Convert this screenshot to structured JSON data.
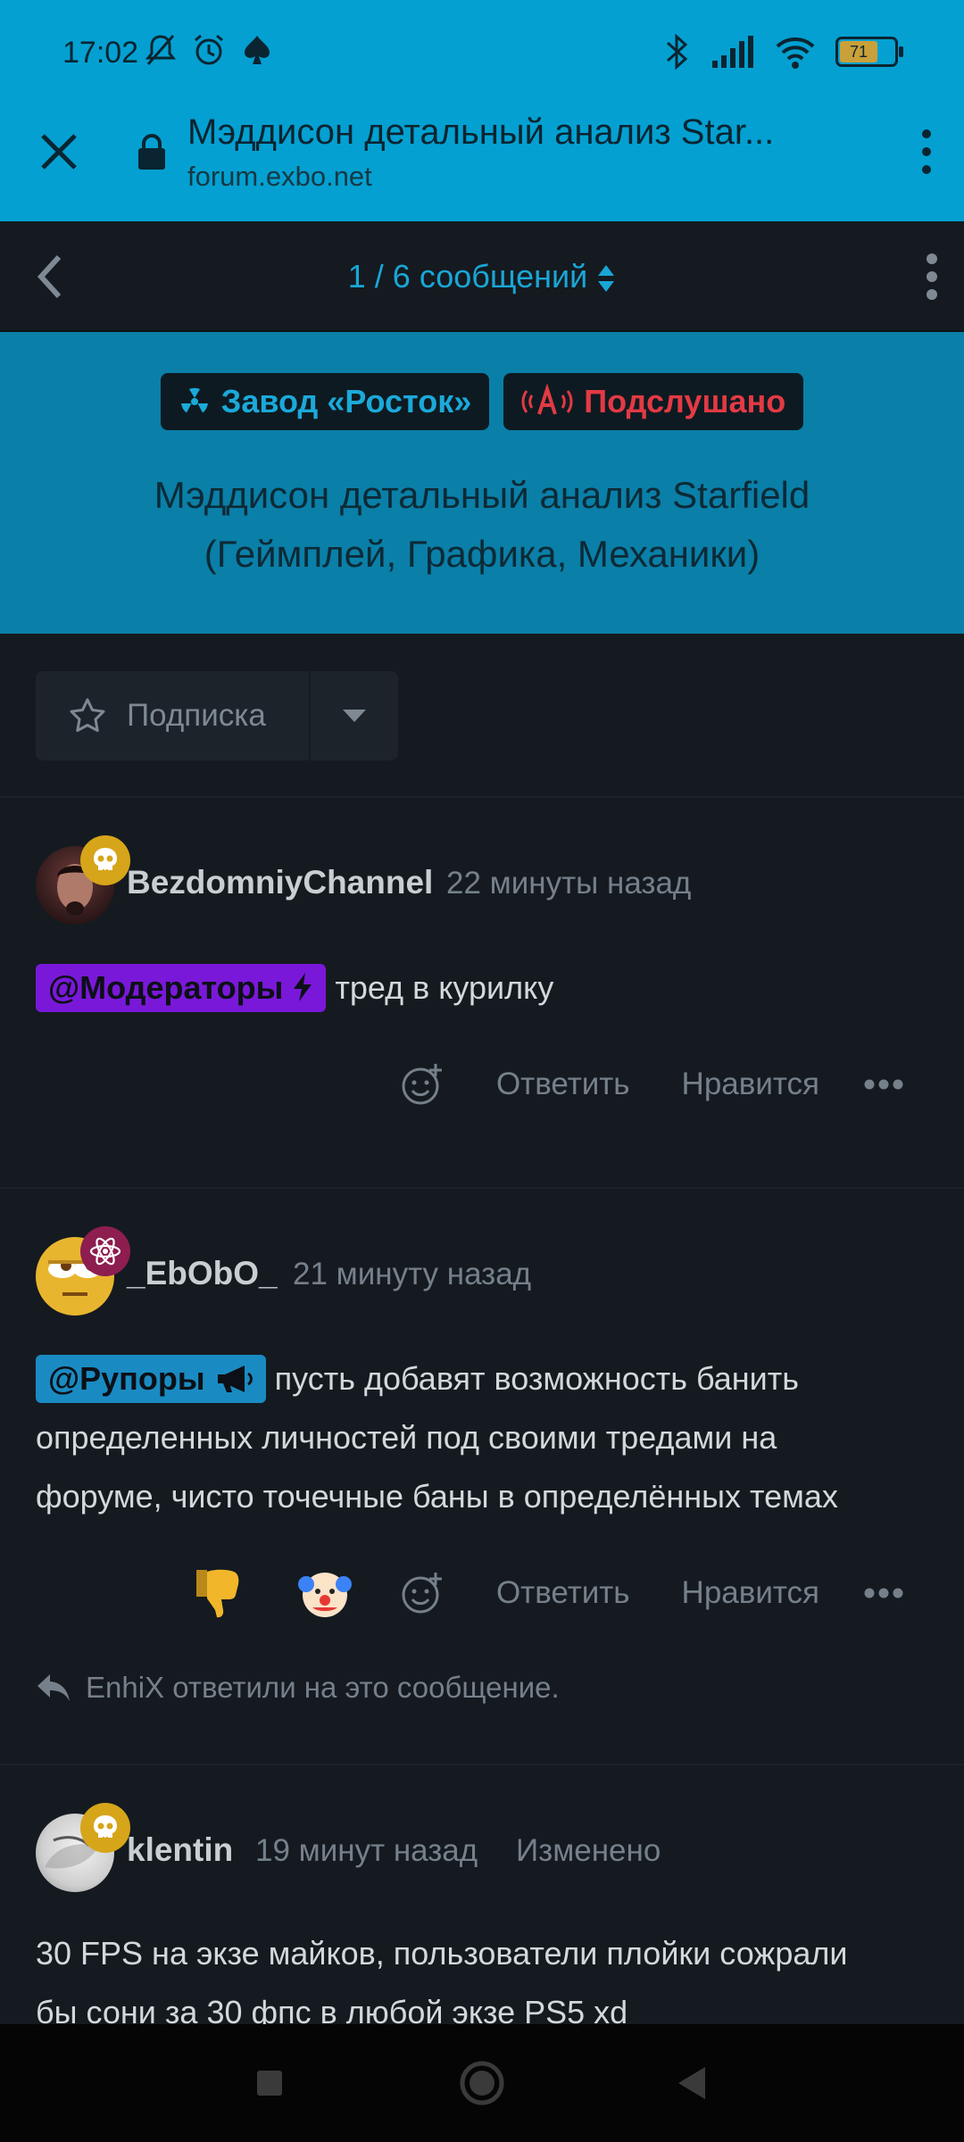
{
  "status_bar": {
    "time": "17:02",
    "battery": "71"
  },
  "browser": {
    "page_title": "Мэддисон детальный анализ Star...",
    "url": "forum.exbo.net"
  },
  "forum_header": {
    "pager": "1 / 6 сообщений"
  },
  "topic": {
    "tags": [
      {
        "label": "Завод «Росток»",
        "icon": "radiation-icon",
        "color": "#1ba9d9"
      },
      {
        "label": "Подслушано",
        "icon": "broadcast-icon",
        "color": "#e23a44"
      }
    ],
    "title_line1": "Мэддисон детальный анализ Starfield",
    "title_line2": "(Геймплей, Графика, Механики)"
  },
  "subscription": {
    "label": "Подписка"
  },
  "actions": {
    "reply": "Ответить",
    "like": "Нравится"
  },
  "posts": [
    {
      "author": "BezdomniyChannel",
      "time": "22 минуты назад",
      "mention": "@Модераторы",
      "text": "тред в курилку"
    },
    {
      "author": "_EbObO_",
      "time": "21 минуту назад",
      "mention": "@Рупоры",
      "text_line1": "пусть добавят возможность банить",
      "text_line2": "определенных личностей под своими тредами на",
      "text_line3": "форуме, чисто точечные баны в определённых темах",
      "reply_note": "EnhiX ответили на это сообщение."
    },
    {
      "author": "klentin",
      "time": "19 минут назад",
      "edited": "Изменено",
      "text_line1": "30 FPS на экзе майков, пользователи плойки сожрали",
      "text_line2": "бы сони за 30 фпс в любой экзе PS5 xd"
    }
  ]
}
